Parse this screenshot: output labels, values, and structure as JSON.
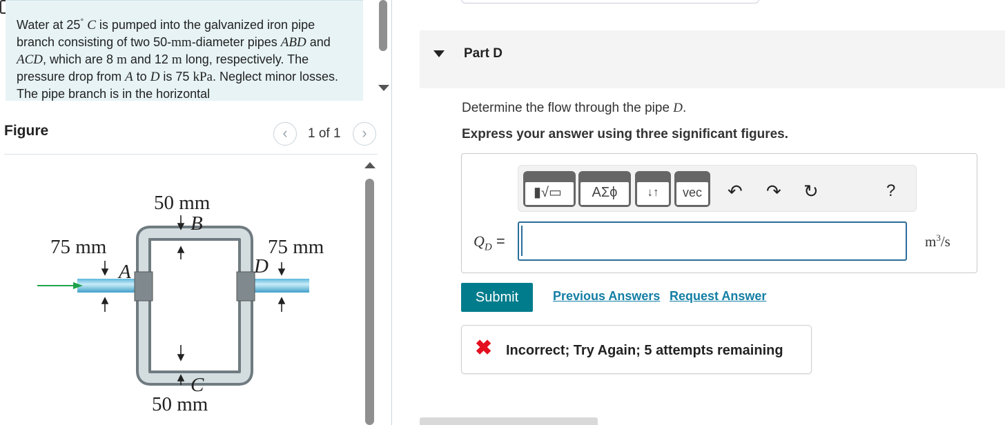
{
  "problem": {
    "parts": [
      {
        "t": "Water at 25"
      },
      {
        "t": "°",
        "sup": true
      },
      {
        "t": " "
      },
      {
        "t": "C",
        "math": true
      },
      {
        "t": " is pumped into the galvanized iron pipe branch consisting of two 50-"
      },
      {
        "t": "mm",
        "math": true
      },
      {
        "t": "-diameter pipes "
      },
      {
        "t": "ABD",
        "math": true
      },
      {
        "t": " and "
      },
      {
        "t": "ACD",
        "math": true
      },
      {
        "t": ", which are 8 "
      },
      {
        "t": "m",
        "math": true
      },
      {
        "t": " and 12 "
      },
      {
        "t": "m",
        "math": true
      },
      {
        "t": " long, respectively. The pressure drop from "
      },
      {
        "t": "A",
        "math": true
      },
      {
        "t": " to "
      },
      {
        "t": "D",
        "math": true
      },
      {
        "t": " is 75 "
      },
      {
        "t": "kPa",
        "math": true
      },
      {
        "t": ". Neglect minor losses. The pipe branch is in the horizontal"
      }
    ]
  },
  "figure": {
    "title": "Figure",
    "pager_text": "1 of 1",
    "labels": {
      "top_dim": "50 mm",
      "top_point": "B",
      "left_dim": "75 mm",
      "left_point": "A",
      "right_dim": "75 mm",
      "right_point": "D",
      "bottom_point": "C",
      "bottom_dim": "50 mm"
    }
  },
  "part": {
    "title": "Part D",
    "question_prefix": "Determine the flow through the pipe ",
    "question_var": "D",
    "question_suffix": ".",
    "instruction": "Express your answer using three significant figures."
  },
  "toolbar": {
    "symbols_label": "ΑΣϕ",
    "arrows_label": "↓↑",
    "vec_label": "vec",
    "help_label": "?",
    "icons": [
      "templates-icon",
      "symbols-icon",
      "arrows-icon",
      "vec-icon",
      "undo-icon",
      "redo-icon",
      "reset-icon",
      "keyboard-icon",
      "help-icon"
    ]
  },
  "answer": {
    "var_label": "Q",
    "var_sub": "D",
    "equals": "=",
    "value": "",
    "unit_base": "m",
    "unit_exp": "3",
    "unit_tail": "/s"
  },
  "actions": {
    "submit": "Submit",
    "previous_answers": "Previous Answers",
    "request_answer": "Request Answer"
  },
  "feedback": {
    "icon": "✖",
    "text": "Incorrect; Try Again; 5 attempts remaining",
    "color": "#e4101f"
  },
  "colors": {
    "accent": "#007c8c",
    "link": "#137ea4",
    "problem_bg": "#e7f3f5"
  }
}
